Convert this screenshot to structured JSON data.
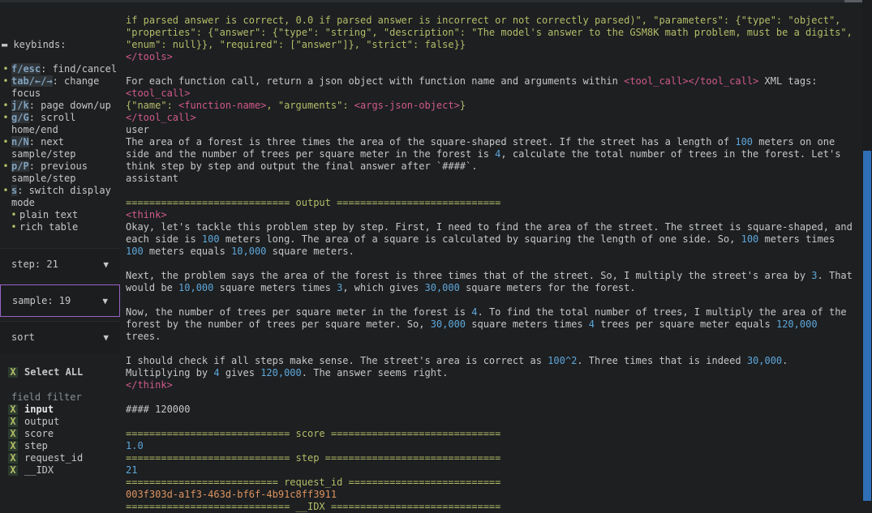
{
  "sidebar": {
    "keybinds_title": "keybinds:",
    "keybinds": [
      {
        "key": "f/esc",
        "text": ": find/cancel"
      },
      {
        "key": "tab/←/→",
        "text": ": change focus"
      },
      {
        "key": "j/k",
        "text": ": page down/up"
      },
      {
        "key": "g/G",
        "text": ": scroll home/end"
      },
      {
        "key": "n/N",
        "text": ": next sample/step"
      },
      {
        "key": "p/P",
        "text": ": previous sample/step"
      },
      {
        "key": "s",
        "text": ": switch display mode"
      }
    ],
    "display_modes": [
      "plain text",
      "rich table"
    ],
    "dropdowns": {
      "step": "step: 21",
      "sample": "sample: 19",
      "sort": "sort"
    },
    "select_all": "Select ALL",
    "field_filter_label": "field filter",
    "fields": [
      "input",
      "output",
      "score",
      "step",
      "request_id",
      "__IDX"
    ],
    "check_mark": "X"
  },
  "main": {
    "l1a": "if parsed answer is correct, 0.0 if parsed answer is incorrect or not correctly parsed)\", \"parameters\": {\"type\": \"object\",",
    "l2": "\"properties\": {\"answer\": {\"type\": \"string\", \"description\": \"The model's answer to the GSM8K math problem, must be a digits\",",
    "l3": "\"enum\": null}}, \"required\": [\"answer\"]}, \"strict\": false}}",
    "tools_close": "</tools>",
    "fc_intro": "For each function call, return a json object with function name and arguments within ",
    "tc_open": "<tool_call>",
    "tc_close": "</tool_call>",
    "fc_tail": " XML tags:",
    "fc_json_a": "{\"name\": ",
    "fc_json_b": "<function-name>",
    "fc_json_c": ", \"arguments\": ",
    "fc_json_d": "<args-json-object>",
    "fc_json_e": "}",
    "user": "user",
    "q1": "The area of a forest is three times the area of the square-shaped street. If the street has a length of ",
    "q_100": "100",
    "q2": " meters on one side and the number of trees per square meter in the forest is ",
    "q_4": "4",
    "q3": ", calculate the total number of trees in the forest. Let's think step by step and output the final answer after `####`.",
    "assistant": "assistant",
    "sep_output": "============================ output ============================",
    "think_open": "<think>",
    "p1a": "Okay, let's tackle this problem step by step. First, I need to find the area of the street. The street is square-shaped, and each side is ",
    "p1b": " meters long. The area of a square is calculated by squaring the length of one side. So, ",
    "p1c": " meters times ",
    "p1d": " meters equals ",
    "p1e": " square meters.",
    "n100": "100",
    "n10000": "10,000",
    "p2a": "Next, the problem says the area of the forest is three times that of the street. So, I multiply the street's area by ",
    "n3": "3",
    "p2b": ". That would be ",
    "p2c": " square meters times ",
    "p2d": ", which gives ",
    "n30000": "30,000",
    "p2e": " square meters for the forest.",
    "p3a": "Now, the number of trees per square meter in the forest is ",
    "n4": "4",
    "p3b": ". To find the total number of trees, I multiply the area of the forest by the number of trees per square meter. So, ",
    "p3c": " square meters times ",
    "p3d": " trees per square meter equals ",
    "n120000": "120,000",
    "p3e": " trees.",
    "p4a": "I should check if all steps make sense. The street's area is correct as ",
    "n100sq": "100^2",
    "p4b": ". Three times that is indeed ",
    "p4c": ". Multiplying by ",
    "p4d": " gives ",
    "p4e": ". The answer seems right.",
    "think_close": "</think>",
    "final": "#### 120000",
    "sep_score": "============================ score =============================",
    "score": "1.0",
    "sep_step": "============================ step ==============================",
    "step": "21",
    "sep_req": "========================== request_id ==========================",
    "request_id": "003f303d-a1f3-463d-bf6f-4b91c8ff3911",
    "sep_idx": "============================ __IDX ============================="
  }
}
